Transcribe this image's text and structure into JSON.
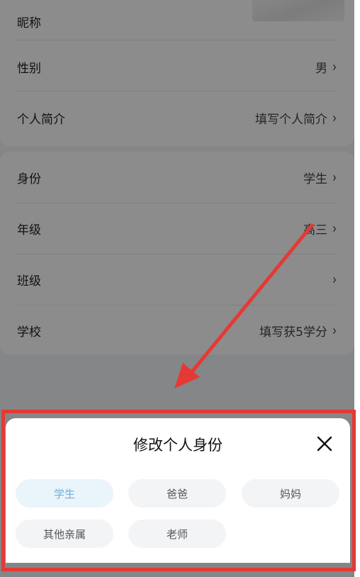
{
  "profile_card": {
    "rows": [
      {
        "label": "昵称",
        "value": ""
      },
      {
        "label": "性别",
        "value": "男"
      },
      {
        "label": "个人简介",
        "value": "填写个人简介"
      }
    ]
  },
  "school_card": {
    "rows": [
      {
        "label": "身份",
        "value": "学生"
      },
      {
        "label": "年级",
        "value": "高三"
      },
      {
        "label": "班级",
        "value": ""
      },
      {
        "label": "学校",
        "value": "填写获5学分"
      }
    ]
  },
  "chevron": "›",
  "identity_sheet": {
    "title": "修改个人身份",
    "close_icon": "close-icon",
    "options": [
      {
        "label": "学生",
        "selected": true
      },
      {
        "label": "爸爸",
        "selected": false
      },
      {
        "label": "妈妈",
        "selected": false
      },
      {
        "label": "其他亲属",
        "selected": false
      },
      {
        "label": "老师",
        "selected": false
      }
    ]
  },
  "annotation": {
    "color": "#e53935"
  }
}
